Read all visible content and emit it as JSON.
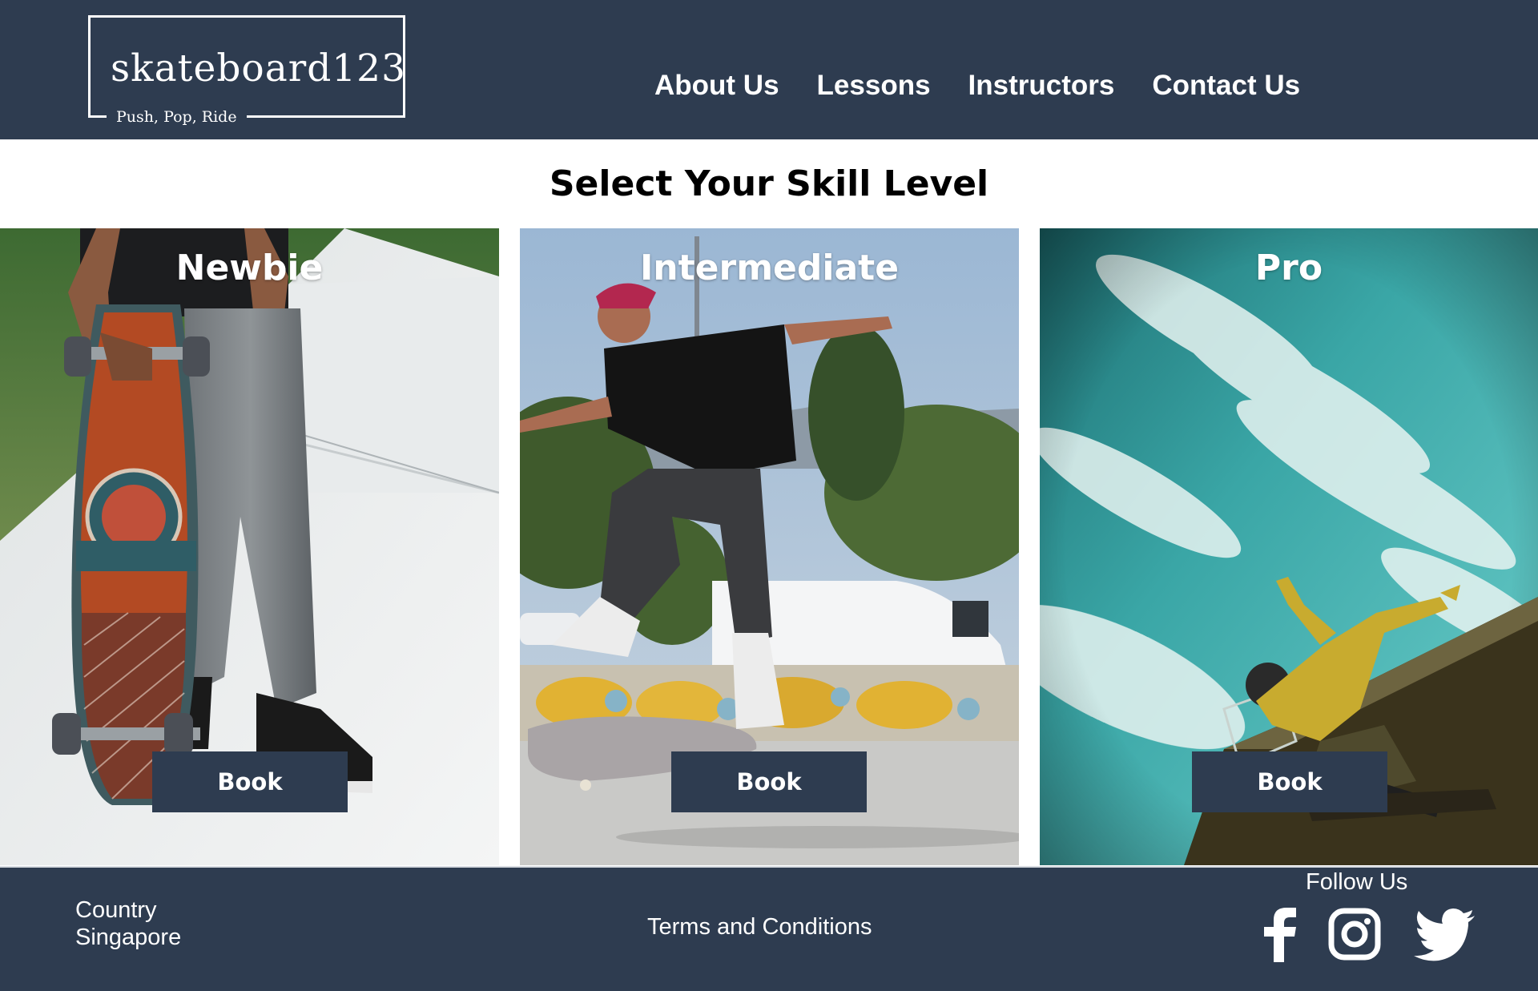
{
  "header": {
    "logo": {
      "name": "skateboard123",
      "tagline": "Push, Pop, Ride"
    },
    "nav": [
      {
        "label": "About Us"
      },
      {
        "label": "Lessons"
      },
      {
        "label": "Instructors"
      },
      {
        "label": "Contact Us"
      }
    ]
  },
  "main": {
    "title": "Select Your Skill Level",
    "cards": [
      {
        "title": "Newbie",
        "button_label": "Book"
      },
      {
        "title": "Intermediate",
        "button_label": "Book"
      },
      {
        "title": "Pro",
        "button_label": "Book"
      }
    ]
  },
  "footer": {
    "country_label": "Country",
    "country_value": "Singapore",
    "terms_label": "Terms and Conditions",
    "follow_label": "Follow Us",
    "social": [
      "facebook-icon",
      "instagram-icon",
      "twitter-icon"
    ]
  },
  "colors": {
    "brand_navy": "#2e3c50",
    "text_white": "#ffffff",
    "title_black": "#000000"
  }
}
